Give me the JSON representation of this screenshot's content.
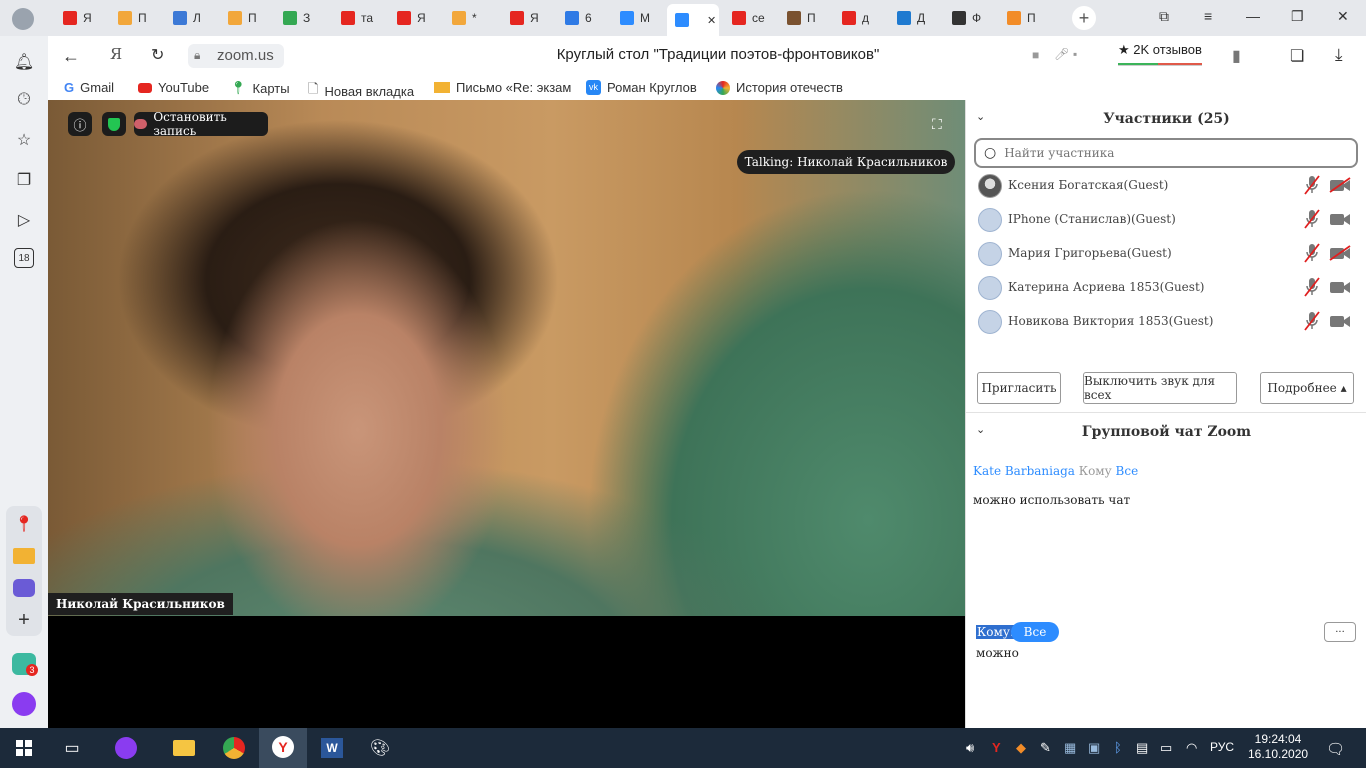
{
  "tabs": [
    {
      "label": "Я",
      "fav_color": "#e52620"
    },
    {
      "label": "П",
      "fav_color": "#f2a73b"
    },
    {
      "label": "Л",
      "fav_color": "#3c79d6"
    },
    {
      "label": "П",
      "fav_color": "#f2a73b"
    },
    {
      "label": "З",
      "fav_color": "#34a853"
    },
    {
      "label": "та",
      "fav_color": "#e52620"
    },
    {
      "label": "Я",
      "fav_color": "#e52620"
    },
    {
      "label": "*",
      "fav_color": "#f2a73b"
    },
    {
      "label": "Я",
      "fav_color": "#e52620"
    },
    {
      "label": "6",
      "fav_color": "#2f7ae5"
    },
    {
      "label": "М",
      "fav_color": "#2d8cff"
    },
    {
      "label": "",
      "fav_color": "#2d8cff"
    },
    {
      "label": "се",
      "fav_color": "#e52620"
    },
    {
      "label": "П",
      "fav_color": "#7a5230"
    },
    {
      "label": "д",
      "fav_color": "#e52620"
    },
    {
      "label": "Д",
      "fav_color": "#1f7ad0"
    },
    {
      "label": "Ф",
      "fav_color": "#333333"
    },
    {
      "label": "П",
      "fav_color": "#f28c28"
    }
  ],
  "address": {
    "url": "zoom.us",
    "page_title": "Круглый стол \"Традиции поэтов-фронтовиков\"",
    "reviews": "★ 2K отзывов"
  },
  "bookmarks": [
    {
      "label": "Gmail"
    },
    {
      "label": "YouTube"
    },
    {
      "label": "Карты"
    },
    {
      "label": "Новая вкладка"
    },
    {
      "label": "Письмо «Re: экзам"
    },
    {
      "label": "Роман Круглов"
    },
    {
      "label": "История отечеств"
    }
  ],
  "sidebar": {
    "badge_18": "18",
    "messenger_badge": "3"
  },
  "video": {
    "stop_recording": "Остановить запись",
    "talking": "Talking: Николай Красильников",
    "speaker_name": "Николай Красильников"
  },
  "participants": {
    "title": "Участники (25)",
    "search_placeholder": "Найти участника",
    "list": [
      {
        "name": "Ксения Богатская(Guest)",
        "photo": true,
        "cam_off": true
      },
      {
        "name": "IPhone (Станислав)(Guest)",
        "photo": false,
        "cam_off": false
      },
      {
        "name": "Мария Григорьева(Guest)",
        "photo": false,
        "cam_off": true
      },
      {
        "name": "Катерина Асриева 1853(Guest)",
        "photo": false,
        "cam_off": false
      },
      {
        "name": "Новикова Виктория 1853(Guest)",
        "photo": false,
        "cam_off": false
      }
    ],
    "invite": "Пригласить",
    "mute_all": "Выключить звук для всех",
    "more": "Подробнее ▴"
  },
  "chat": {
    "title": "Групповой чат Zoom",
    "sender": "Kate Barbaniaga",
    "to_word": "Кому",
    "to_target": "Все",
    "message": "можно использовать чат",
    "to_label": "Кому:",
    "to_button": "Все",
    "more": "···",
    "draft": "можно"
  },
  "taskbar": {
    "lang": "РУС",
    "time": "19:24:04",
    "date": "16.10.2020"
  }
}
